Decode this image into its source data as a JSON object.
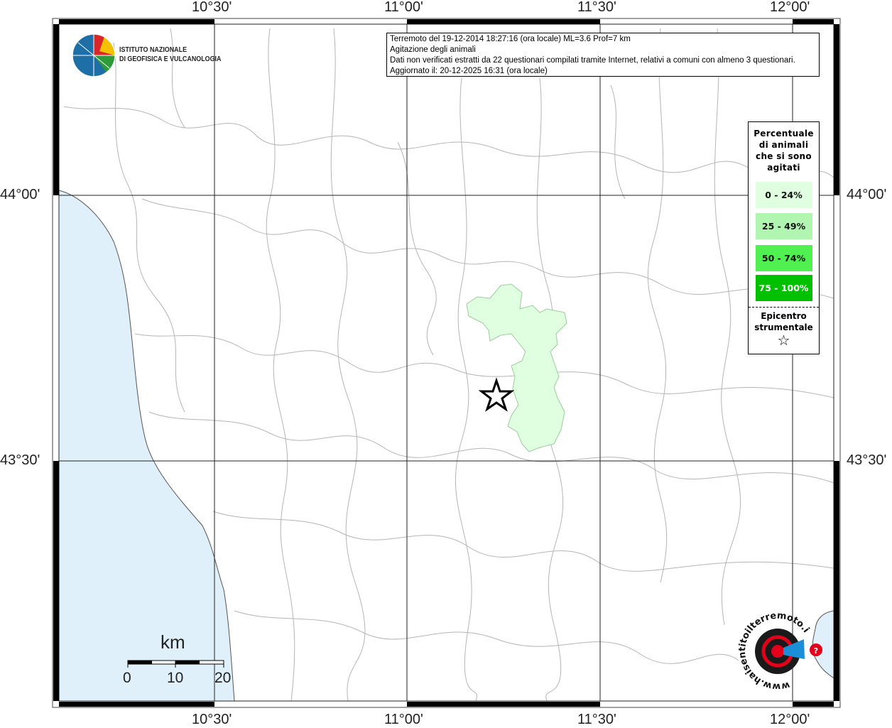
{
  "info": {
    "line1": "Terremoto del 19-12-2014 18:27:16 (ora locale) ML=3.6 Prof=7 km",
    "line2": "Agitazione degli animali",
    "line3": "Dati non verificati estratti da 22 questionari compilati tramite Internet, relativi a comuni con almeno 3 questionari.",
    "line4": "Aggiornato il: 20-12-2025 16:31 (ora locale)"
  },
  "logo": {
    "line1": "ISTITUTO NAZIONALE",
    "line2": "DI GEOFISICA E VULCANOLOGIA"
  },
  "logo2": {
    "text": "www.haisentitoilterremoto.it"
  },
  "axes": {
    "longitudes": [
      "10°30'",
      "11°00'",
      "11°30'",
      "12°00'"
    ],
    "latitudes": [
      "44°00'",
      "43°30'"
    ]
  },
  "legend": {
    "title_lines": [
      "Percentuale",
      "di animali",
      "che si sono",
      "agitati"
    ],
    "classes": [
      {
        "label": "0 - 24%",
        "color": "#e0ffe0"
      },
      {
        "label": "25 - 49%",
        "color": "#b0f5b0"
      },
      {
        "label": "50 - 74%",
        "color": "#50f050"
      },
      {
        "label": "75 - 100%",
        "color": "#00c000"
      }
    ],
    "epicenter_lines": [
      "Epicentro",
      "strumentale"
    ],
    "epicenter_icon": "star-outline"
  },
  "scalebar": {
    "unit": "km",
    "ticks": [
      "0",
      "10",
      "20"
    ]
  },
  "colors": {
    "sea": "#dff0fb",
    "coast": "#555555",
    "borders": "#aaaaaa",
    "affected_municipalities": "#e0ffe0"
  }
}
